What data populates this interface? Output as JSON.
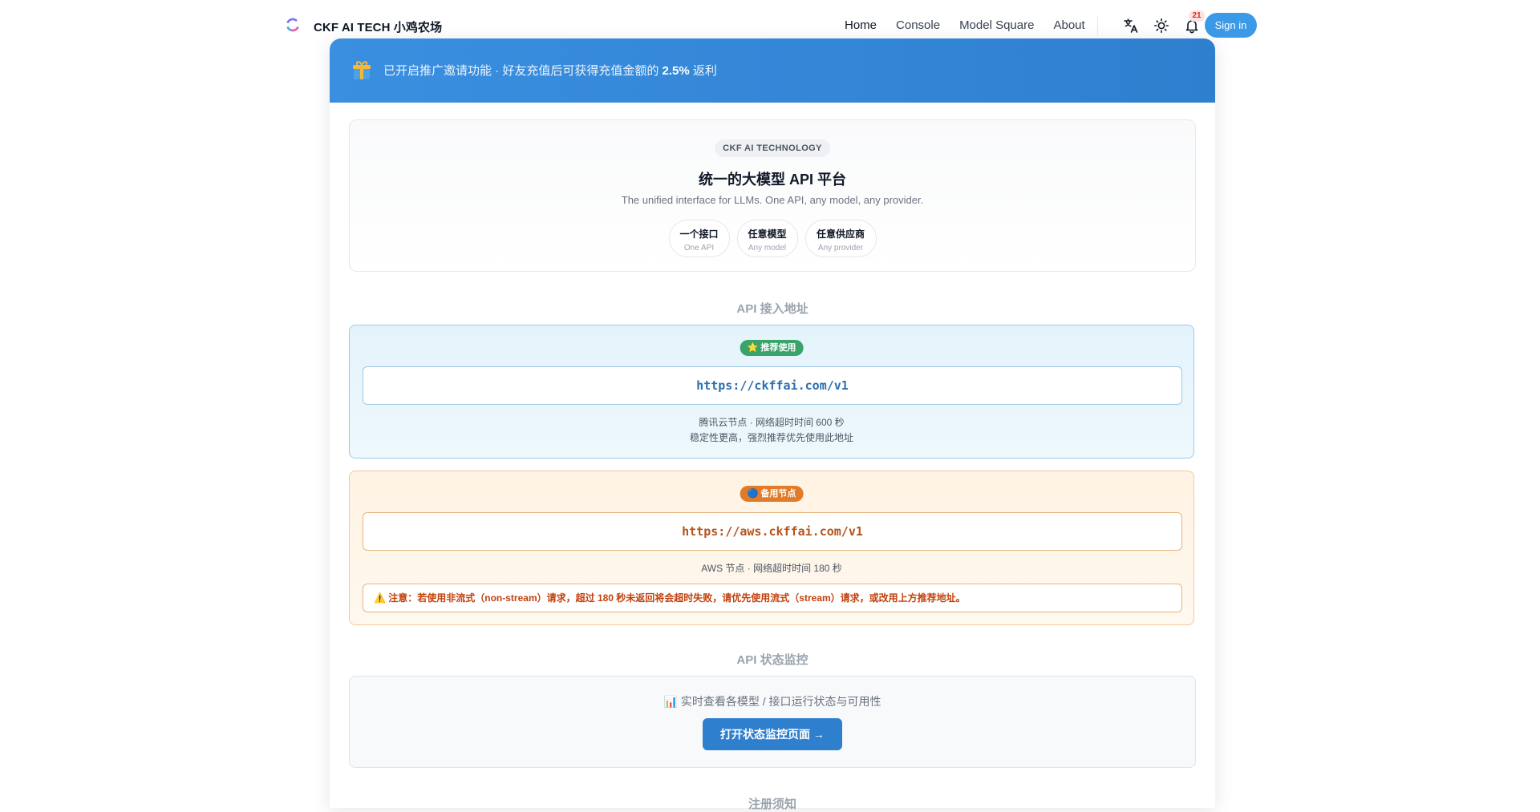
{
  "nav": {
    "brand": "CKF AI TECH 小鸡农场",
    "links": [
      "Home",
      "Console",
      "Model Square",
      "About"
    ],
    "notification_count": "21",
    "signin_label": "Sign in"
  },
  "banner": {
    "text_before": "已开启推广邀请功能 · 好友充值后可获得充值金额的 ",
    "rate": "2.5%",
    "text_after": " 返利"
  },
  "hero": {
    "tag": "CKF AI TECHNOLOGY",
    "title": "统一的大模型 API 平台",
    "subtitle": "The unified interface for LLMs. One API, any model, any provider.",
    "pills": [
      {
        "main": "一个接口",
        "sub": "One API"
      },
      {
        "main": "任意模型",
        "sub": "Any model"
      },
      {
        "main": "任意供应商",
        "sub": "Any provider"
      }
    ]
  },
  "api_section": {
    "title": "API 接入地址",
    "primary": {
      "badge": "⭐ 推荐使用",
      "url": "https://ckffai.com/v1",
      "note1": "腾讯云节点 · 网络超时时间 600 秒",
      "note2": "稳定性更高，强烈推荐优先使用此地址"
    },
    "backup": {
      "badge": "🔵 备用节点",
      "url": "https://aws.ckffai.com/v1",
      "note": "AWS 节点 · 网络超时时间 180 秒",
      "warning": "⚠️ 注意：若使用非流式（non-stream）请求，超过 180 秒未返回将会超时失败，请优先使用流式（stream）请求，或改用上方推荐地址。"
    }
  },
  "monitor_section": {
    "title": "API 状态监控",
    "text": "📊 实时查看各模型 / 接口运行状态与可用性",
    "button": "打开状态监控页面 →"
  },
  "next_section_title": "注册须知",
  "colors": {
    "accent": "#2f7fcf",
    "signin": "#3b9ae8",
    "primary_badge": "#3aa36a",
    "backup_badge": "#e07b2a",
    "warning_text": "#c2410c"
  }
}
